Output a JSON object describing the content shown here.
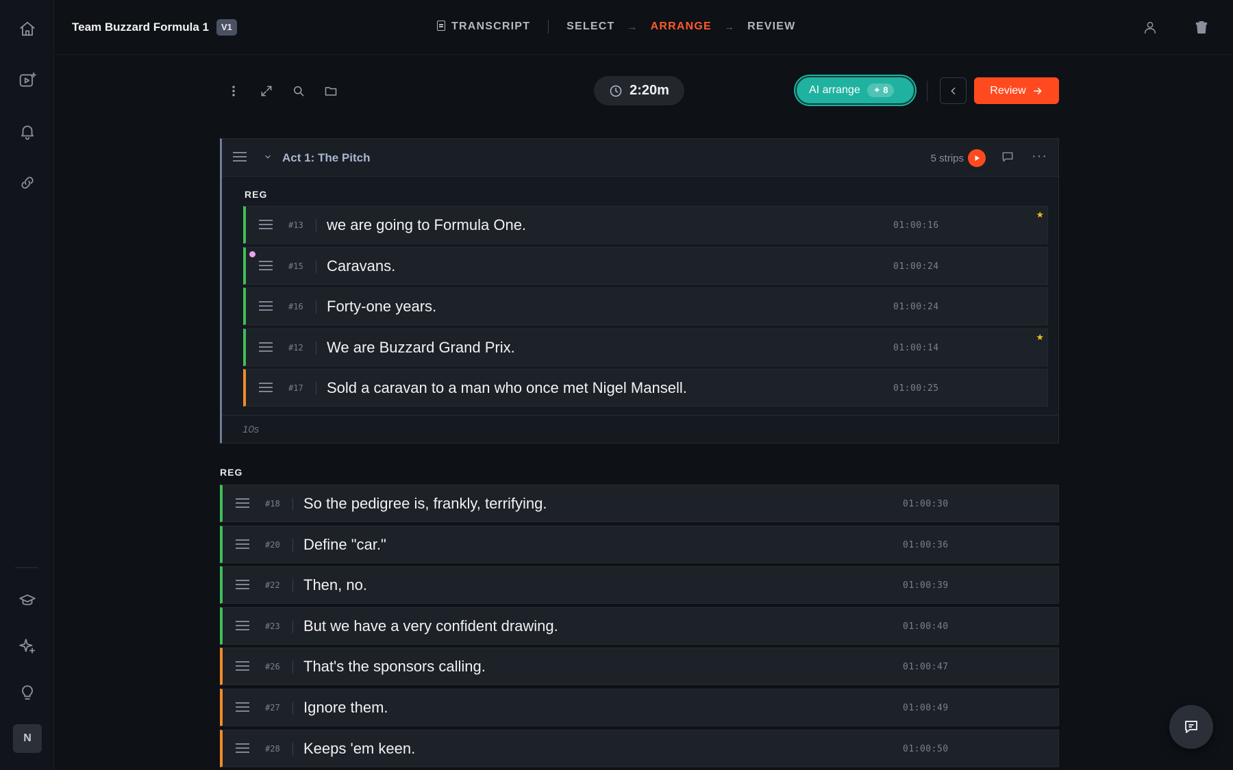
{
  "project": {
    "title": "Team Buzzard Formula 1",
    "version": "V1"
  },
  "steps": [
    {
      "label": "TRANSCRIPT",
      "state": "done"
    },
    {
      "label": "SELECT",
      "state": "done"
    },
    {
      "label": "ARRANGE",
      "state": "active"
    },
    {
      "label": "REVIEW",
      "state": "pending"
    }
  ],
  "toolbar": {
    "duration": "2:20m",
    "ai_arrange_label": "AI arrange",
    "ai_arrange_badge": "✦ 8",
    "review_label": "Review"
  },
  "colors": {
    "accent": "#ff4a1f",
    "ai": "#1fb2a0",
    "keep": "#3fbf5a",
    "maybe": "#f08c2a",
    "act_bar": "#6f7f98"
  },
  "act": {
    "title": "Act 1: The Pitch",
    "count_label": "5 strips",
    "region_label": "REG",
    "duration_label": "10s",
    "strips": [
      {
        "num": "#13",
        "text": "we are going to Formula One.",
        "timecode": "01:00:16",
        "status": "keep",
        "starred": true,
        "dot": false
      },
      {
        "num": "#15",
        "text": "Caravans.",
        "timecode": "01:00:24",
        "status": "keep",
        "starred": false,
        "dot": true
      },
      {
        "num": "#16",
        "text": "Forty-one years.",
        "timecode": "01:00:24",
        "status": "keep",
        "starred": false,
        "dot": false
      },
      {
        "num": "#12",
        "text": "We are Buzzard Grand Prix.",
        "timecode": "01:00:14",
        "status": "keep",
        "starred": true,
        "dot": false
      },
      {
        "num": "#17",
        "text": "Sold a caravan to a man who once met Nigel Mansell.",
        "timecode": "01:00:25",
        "status": "maybe",
        "starred": false,
        "dot": false
      }
    ]
  },
  "loose": {
    "region_label": "REG",
    "strips": [
      {
        "num": "#18",
        "text": "So the pedigree is, frankly, terrifying.",
        "timecode": "01:00:30",
        "status": "keep"
      },
      {
        "num": "#20",
        "text": "Define \"car.\"",
        "timecode": "01:00:36",
        "status": "keep"
      },
      {
        "num": "#22",
        "text": "Then, no.",
        "timecode": "01:00:39",
        "status": "keep"
      },
      {
        "num": "#23",
        "text": "But we have a very confident drawing.",
        "timecode": "01:00:40",
        "status": "keep"
      },
      {
        "num": "#26",
        "text": "That's the sponsors calling.",
        "timecode": "01:00:47",
        "status": "maybe"
      },
      {
        "num": "#27",
        "text": "Ignore them.",
        "timecode": "01:00:49",
        "status": "maybe"
      },
      {
        "num": "#28",
        "text": "Keeps 'em keen.",
        "timecode": "01:00:50",
        "status": "maybe"
      }
    ]
  },
  "icons": {
    "sidebar": [
      "home-icon",
      "video-add-icon",
      "bell-icon",
      "link-icon",
      "graduation-cap-icon",
      "sparkle-icon",
      "lightbulb-icon"
    ],
    "user_initial": "N"
  }
}
